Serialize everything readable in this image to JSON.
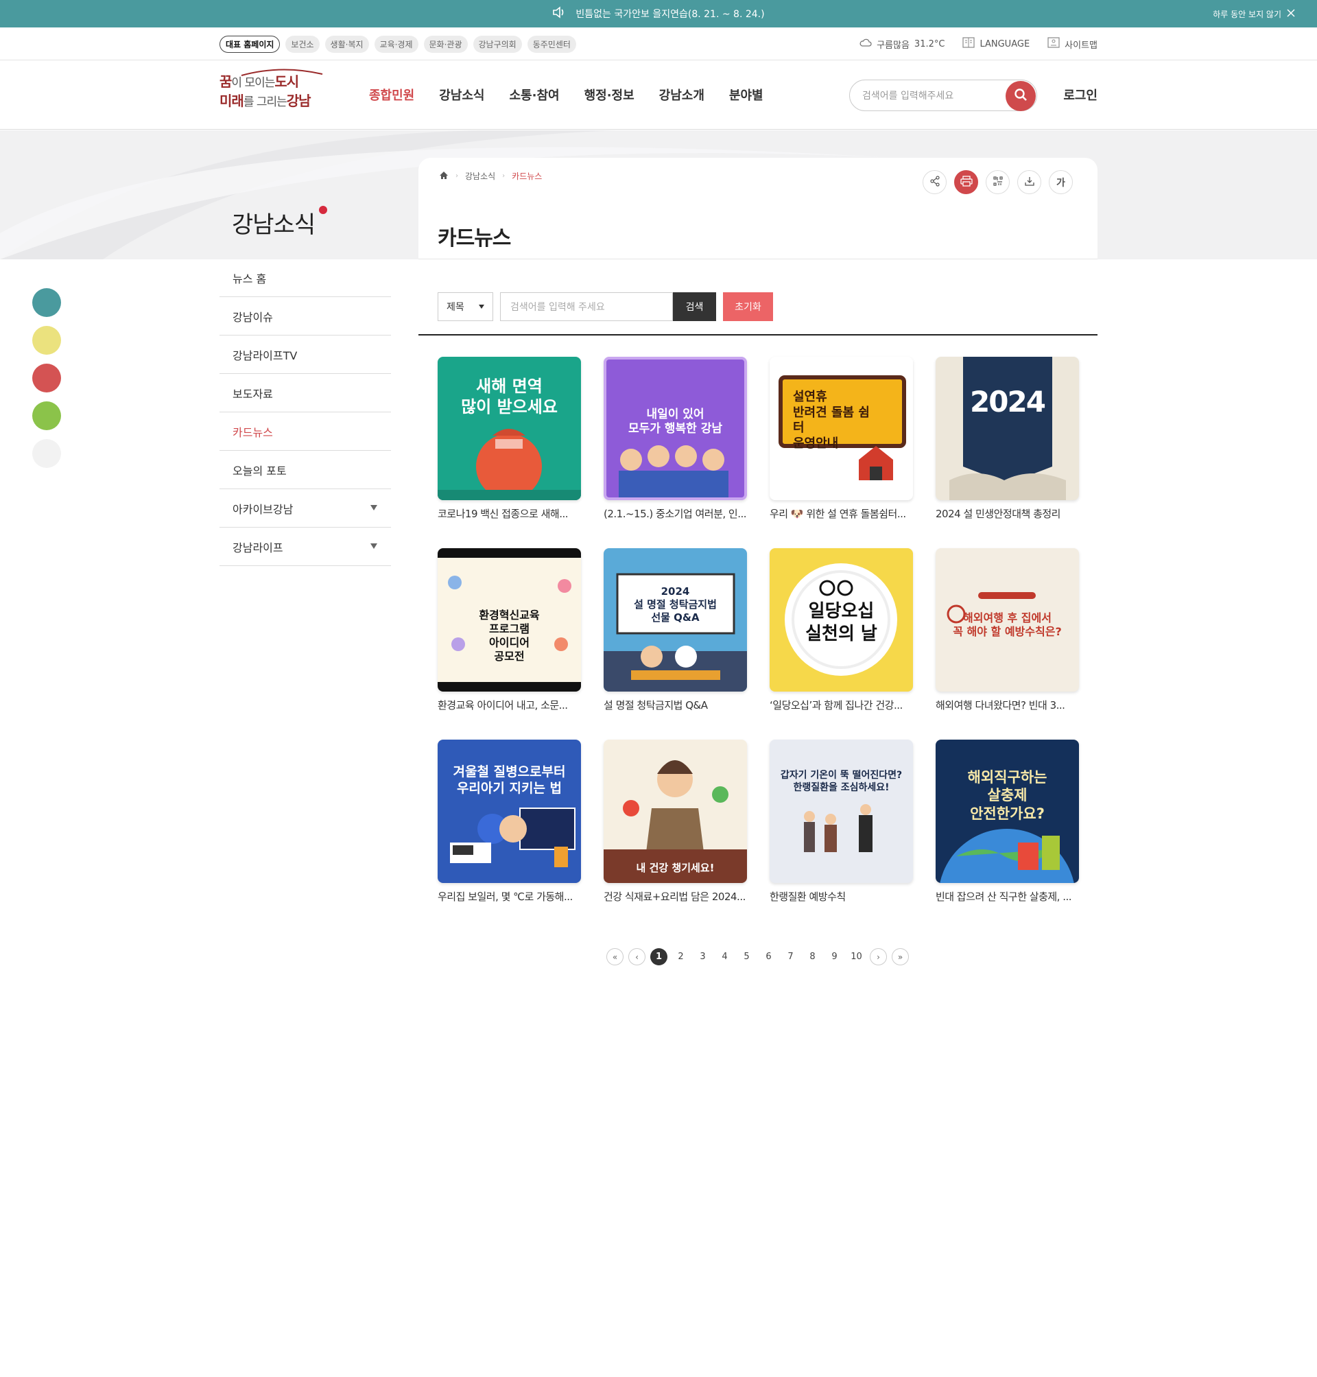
{
  "notice": {
    "message": "빈틈없는 국가안보 을지연습(8. 21. ~ 8. 24.)",
    "close_label": "하루 동안 보지 않기"
  },
  "util": {
    "chips": [
      "대표 홈페이지",
      "보건소",
      "생활·복지",
      "교육·경제",
      "문화·관광",
      "강남구의회",
      "동주민센터"
    ],
    "weather": "구름많음",
    "temperature": "31.2°C",
    "language": "LANGUAGE",
    "sitemap": "사이트맵"
  },
  "header": {
    "logo_line1a": "꿈",
    "logo_line1b": "이 모이는",
    "logo_line1c": "도시",
    "logo_line2a": "미래",
    "logo_line2b": "를 그리는",
    "logo_line2c": "강남",
    "nav": [
      "종합민원",
      "강남소식",
      "소통·참여",
      "행정·정보",
      "강남소개",
      "분야별"
    ],
    "search_placeholder": "검색어를 입력해주세요",
    "login": "로그인"
  },
  "lnb": {
    "title": "강남소식",
    "items": [
      "뉴스 홈",
      "강남이슈",
      "강남라이프TV",
      "보도자료",
      "카드뉴스",
      "오늘의 포토",
      "아카이브강남",
      "강남라이프"
    ]
  },
  "colors": {
    "accent": "#d0484b",
    "teal": "#4a9a9e",
    "dots": [
      "#4a9a9e",
      "#ebe27e",
      "#d45353",
      "#8bc34a",
      "#f2f2f2"
    ]
  },
  "breadcrumb": {
    "level1": "강남소식",
    "level2": "카드뉴스"
  },
  "tools": {
    "font_label": "가"
  },
  "page_title": "카드뉴스",
  "filter": {
    "select_value": "제목",
    "keyword_placeholder": "검색어를 입력해 주세요",
    "search_label": "검색",
    "reset_label": "초기화"
  },
  "cards": [
    {
      "caption": "코로나19 백신 접종으로 새해...",
      "thumb_text": "새해 면역\n많이 받으세요"
    },
    {
      "caption": "(2.1.~15.) 중소기업 여러분, 인...",
      "thumb_text": "내일이 있어\n모두가 행복한 강남"
    },
    {
      "caption": "우리 🐶 위한 설 연휴 돌봄쉼터...",
      "thumb_text": "설연휴\n반려견 돌봄 쉼터\n운영안내"
    },
    {
      "caption": "2024 설 민생안정대책 총정리",
      "thumb_text": "2024"
    },
    {
      "caption": "환경교육 아이디어 내고, 소문...",
      "thumb_text": "환경혁신교육\n프로그램\n아이디어\n공모전"
    },
    {
      "caption": "설 명절 청탁금지법 Q&A",
      "thumb_text": "2024\n설 명절 청탁금지법\n선물 Q&A"
    },
    {
      "caption": "‘일당오십’과 함께 집나간 건강...",
      "thumb_text": "일당오십\n실천의 날"
    },
    {
      "caption": "해외여행 다녀왔다면? 빈대 3...",
      "thumb_text": "해외여행 후 집에서\n꼭 해야 할 예방수칙은?"
    },
    {
      "caption": "우리집 보일러, 몇 ℃로 가동해...",
      "thumb_text": "겨울철 질병으로부터\n우리아기 지키는 법"
    },
    {
      "caption": "건강 식재료+요리법 담은 2024...",
      "thumb_text": "내 건강 챙기세요!"
    },
    {
      "caption": "한랭질환 예방수칙",
      "thumb_text": "갑자기 기온이 뚝 떨어진다면?\n한랭질환을 조심하세요!"
    },
    {
      "caption": "빈대 잡으려 산 직구한 살충제, ...",
      "thumb_text": "해외직구하는\n살충제\n안전한가요?"
    }
  ],
  "paging": {
    "pages": [
      "1",
      "2",
      "3",
      "4",
      "5",
      "6",
      "7",
      "8",
      "9",
      "10"
    ],
    "current": "1"
  }
}
